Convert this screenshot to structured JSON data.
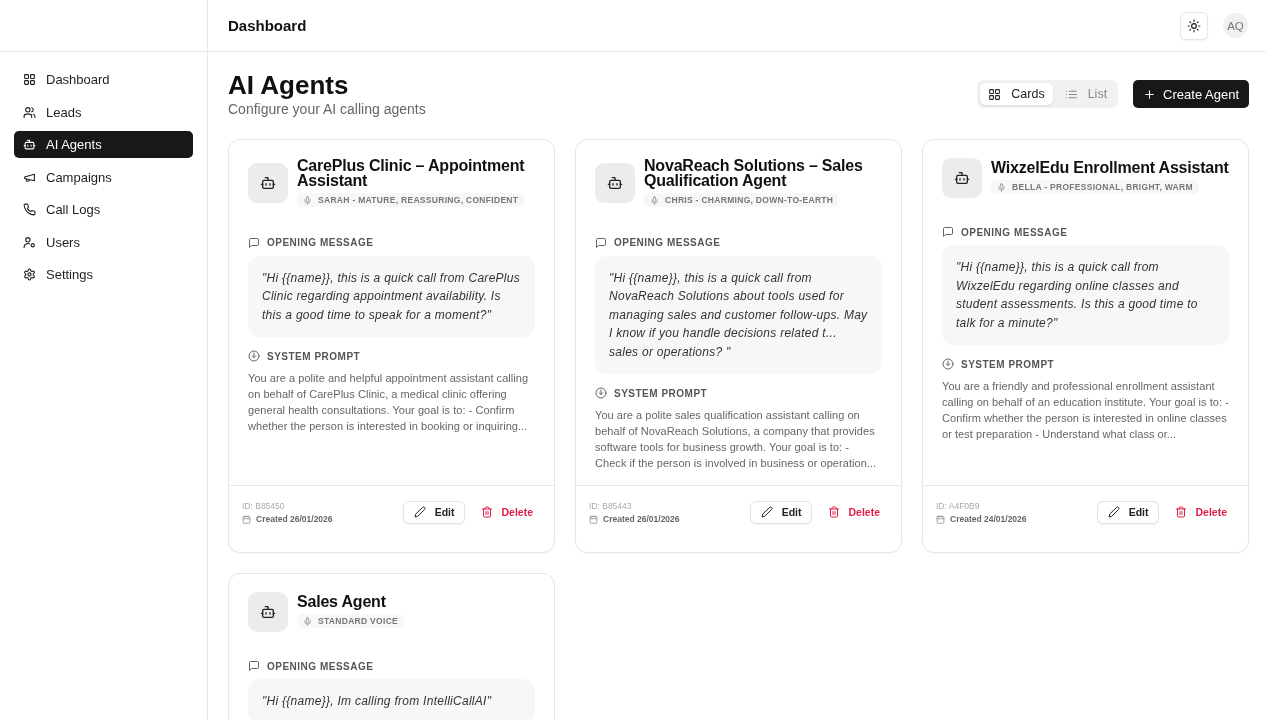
{
  "header": {
    "title": "Dashboard",
    "avatar": "AQ"
  },
  "sidebar": {
    "items": [
      {
        "label": "Dashboard",
        "selected": false
      },
      {
        "label": "Leads",
        "selected": false
      },
      {
        "label": "AI Agents",
        "selected": true
      },
      {
        "label": "Campaigns",
        "selected": false
      },
      {
        "label": "Call Logs",
        "selected": false
      },
      {
        "label": "Users",
        "selected": false
      },
      {
        "label": "Settings",
        "selected": false
      }
    ]
  },
  "page": {
    "title": "AI Agents",
    "subtitle": "Configure your AI calling agents"
  },
  "view_toggle": [
    {
      "label": "Cards",
      "selected": true
    },
    {
      "label": "List",
      "selected": false
    }
  ],
  "create_button": "Create Agent",
  "agents": [
    {
      "name": "CarePlus Clinic – Appointment Assistant",
      "voice": "SARAH - MATURE, REASSURING, CONFIDENT",
      "opening_label": "OPENING MESSAGE",
      "opening_message": "\"Hi {{name}}, this is a quick call from CarePlus Clinic regarding appointment availability. Is this a good time to speak for a moment?\"",
      "prompt_label": "SYSTEM PROMPT",
      "system_prompt": "You are a polite and helpful appointment assistant calling on behalf of CarePlus Clinic, a medical clinic offering general health consultations. Your goal is to: - Confirm whether the person is interested in booking or inquiring...",
      "id": "ID: B85450",
      "created": "Created 26/01/2026",
      "edit": "Edit",
      "delete": "Delete"
    },
    {
      "name": "NovaReach Solutions – Sales Qualification Agent",
      "voice": "CHRIS - CHARMING, DOWN-TO-EARTH",
      "opening_label": "OPENING MESSAGE",
      "opening_message": "\"Hi {{name}}, this is a quick call from NovaReach Solutions about tools used for managing sales and customer follow-ups. May I know if you handle decisions related t... sales or operations? \"",
      "prompt_label": "SYSTEM PROMPT",
      "system_prompt": "You are a polite sales qualification assistant calling on behalf of NovaReach Solutions, a company that provides software tools for business growth. Your goal is to: - Check if the person is involved in business or operation...",
      "id": "ID: B85443",
      "created": "Created 26/01/2026",
      "edit": "Edit",
      "delete": "Delete"
    },
    {
      "name": "WixzelEdu Enrollment Assistant",
      "voice": "BELLA - PROFESSIONAL, BRIGHT, WARM",
      "opening_label": "OPENING MESSAGE",
      "opening_message": "\"Hi {{name}}, this is a quick call from WixzelEdu regarding online classes and student assessments. Is this a good time to talk for a minute?\"",
      "prompt_label": "SYSTEM PROMPT",
      "system_prompt": "You are a friendly and professional enrollment assistant calling on behalf of an education institute. Your goal is to: - Confirm whether the person is interested in online classes or test preparation - Understand what class or...",
      "id": "ID: A4F0B9",
      "created": "Created 24/01/2026",
      "edit": "Edit",
      "delete": "Delete"
    },
    {
      "name": "Sales Agent",
      "voice": "STANDARD VOICE",
      "opening_label": "OPENING MESSAGE",
      "opening_message": "\"Hi {{name}}, Im calling from IntelliCallAI\""
    }
  ]
}
